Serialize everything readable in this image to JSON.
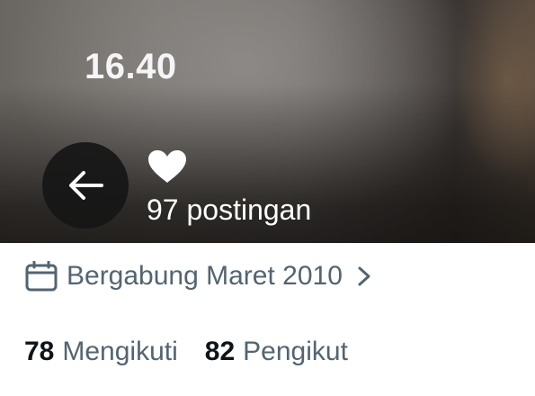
{
  "header": {
    "time": "16.40",
    "back_icon": "arrow-left-icon",
    "heart_icon": "heart-icon",
    "posts_label": "97 postingan"
  },
  "profile": {
    "join_icon": "calendar-icon",
    "joined_label": "Bergabung Maret 2010",
    "joined_chevron_icon": "chevron-right-icon",
    "following_count": "78",
    "following_label": "Mengikuti",
    "followers_count": "82",
    "followers_label": "Pengikut"
  },
  "colors": {
    "secondary_text": "#536471",
    "primary_text": "#0f1419"
  }
}
